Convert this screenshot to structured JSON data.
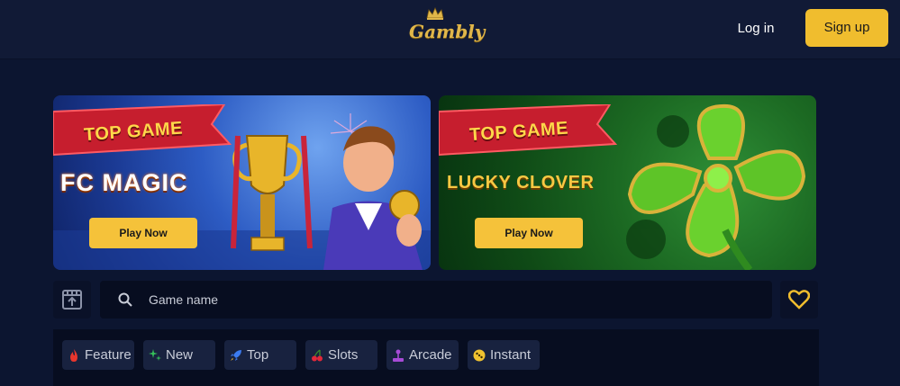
{
  "header": {
    "logo_text": "Gambly",
    "login_label": "Log in",
    "signup_label": "Sign up"
  },
  "banners": [
    {
      "ribbon": "TOP GAME",
      "title": "FC MAGIC",
      "button": "Play Now"
    },
    {
      "ribbon": "TOP GAME",
      "title": "LUCKY CLOVER",
      "button": "Play Now"
    }
  ],
  "search": {
    "placeholder": "Game name"
  },
  "categories": [
    {
      "label": "Feature",
      "icon": "flame-icon",
      "color": "#e8362d"
    },
    {
      "label": "New",
      "icon": "sparkle-icon",
      "color": "#36c25a"
    },
    {
      "label": "Top",
      "icon": "rocket-icon",
      "color": "#3b7bf0"
    },
    {
      "label": "Slots",
      "icon": "cherries-icon",
      "color": "#e0283a"
    },
    {
      "label": "Arcade",
      "icon": "joystick-icon",
      "color": "#a64bd6"
    },
    {
      "label": "Instant",
      "icon": "dice-icon",
      "color": "#f0c230"
    }
  ],
  "colors": {
    "accent": "#f0bd2e",
    "background": "#0c1530",
    "header": "#111a36"
  }
}
